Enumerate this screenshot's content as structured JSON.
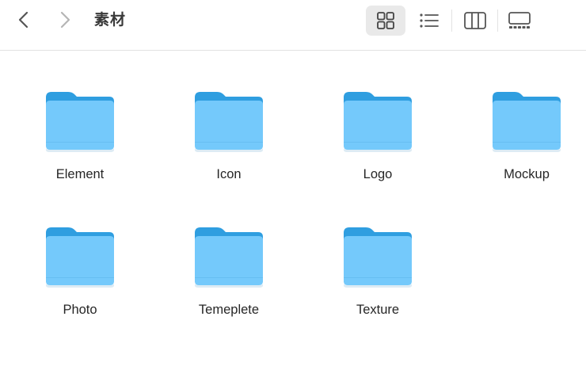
{
  "window": {
    "title": "素材"
  },
  "toolbar": {
    "back_icon": "chevron-left-icon",
    "forward_icon": "chevron-right-icon",
    "views": [
      {
        "name": "icon-view",
        "icon": "grid-icon",
        "selected": true
      },
      {
        "name": "list-view",
        "icon": "list-icon",
        "selected": false
      },
      {
        "name": "column-view",
        "icon": "columns-icon",
        "selected": false
      },
      {
        "name": "gallery-view",
        "icon": "gallery-icon",
        "selected": false
      }
    ]
  },
  "folders": [
    {
      "label": "Element"
    },
    {
      "label": "Icon"
    },
    {
      "label": "Logo"
    },
    {
      "label": "Mockup"
    },
    {
      "label": "Photo"
    },
    {
      "label": "Temeplete"
    },
    {
      "label": "Texture"
    }
  ],
  "colors": {
    "folder_back": "#2f9ee0",
    "folder_front": "#74c9fb",
    "selected_view_bg": "#e9e9e9",
    "text": "#262626"
  }
}
